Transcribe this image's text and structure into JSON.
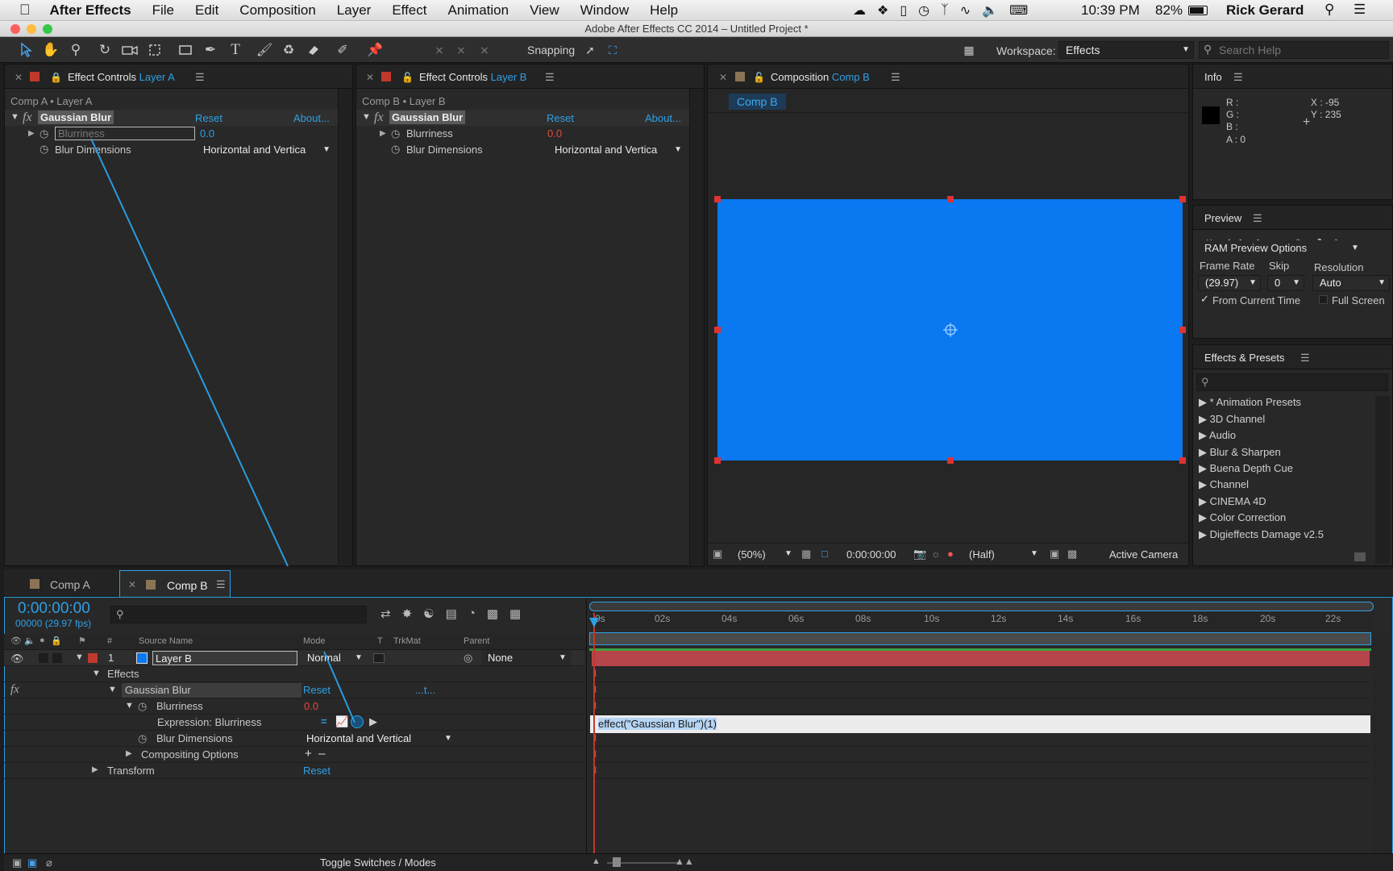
{
  "menubar": {
    "app": "After Effects",
    "items": [
      "File",
      "Edit",
      "Composition",
      "Layer",
      "Effect",
      "Animation",
      "View",
      "Window",
      "Help"
    ],
    "time": "10:39 PM",
    "battery": "82%",
    "user": "Rick Gerard"
  },
  "window": {
    "title": "Adobe After Effects CC 2014 – Untitled Project *"
  },
  "toolbar": {
    "snapping_label": "Snapping",
    "workspace_label": "Workspace:",
    "workspace_value": "Effects",
    "search_placeholder": "Search Help"
  },
  "effect_controls_a": {
    "tab_prefix": "Effect Controls",
    "tab_layer": "Layer A",
    "breadcrumb": "Comp A • Layer A",
    "effect_name": "Gaussian Blur",
    "reset": "Reset",
    "about": "About...",
    "blurriness_label": "Blurriness",
    "blurriness_value": "0.0",
    "dimensions_label": "Blur Dimensions",
    "dimensions_value": "Horizontal and Vertica"
  },
  "effect_controls_b": {
    "tab_prefix": "Effect Controls",
    "tab_layer": "Layer B",
    "breadcrumb": "Comp B • Layer B",
    "effect_name": "Gaussian Blur",
    "reset": "Reset",
    "about": "About...",
    "blurriness_label": "Blurriness",
    "blurriness_value": "0.0",
    "dimensions_label": "Blur Dimensions",
    "dimensions_value": "Horizontal and Vertica"
  },
  "composition": {
    "tab_prefix": "Composition",
    "tab_comp": "Comp B",
    "breadcrumb_tab": "Comp B",
    "solid_color": "#0a78f0",
    "zoom": "(50%)",
    "timecode": "0:00:00:00",
    "resolution": "(Half)",
    "camera": "Active Camera"
  },
  "info": {
    "tab": "Info",
    "r": "R :",
    "g": "G :",
    "b": "B :",
    "a": "A : 0",
    "x": "X : -95",
    "y": "Y : 235"
  },
  "preview": {
    "tab": "Preview",
    "ram_options": "RAM Preview Options",
    "frame_rate_label": "Frame Rate",
    "skip_label": "Skip",
    "resolution_label": "Resolution",
    "frame_rate_value": "(29.97)",
    "skip_value": "0",
    "resolution_value": "Auto",
    "from_current_time": "From Current Time",
    "full_screen": "Full Screen"
  },
  "effects_presets": {
    "tab": "Effects & Presets",
    "items": [
      "* Animation Presets",
      "3D Channel",
      "Audio",
      "Blur & Sharpen",
      "Buena Depth Cue",
      "Channel",
      "CINEMA 4D",
      "Color Correction",
      "Digieffects Damage v2.5"
    ]
  },
  "timeline": {
    "tabs": [
      "Comp A",
      "Comp B"
    ],
    "timecode": "0:00:00:00",
    "frame_info": "00000 (29.97 fps)",
    "columns": {
      "hash": "#",
      "source_name": "Source Name",
      "mode": "Mode",
      "t": "T",
      "trkmat": "TrkMat",
      "parent": "Parent"
    },
    "layer": {
      "index": "1",
      "name": "Layer B",
      "mode": "Normal",
      "parent": "None"
    },
    "effects_label": "Effects",
    "effect_name": "Gaussian Blur",
    "reset": "Reset",
    "about_short": "...t...",
    "blurriness_label": "Blurriness",
    "blurriness_value": "0.0",
    "expression_label": "Expression: Blurriness",
    "blur_dimensions_label": "Blur Dimensions",
    "blur_dimensions_value": "Horizontal and Vertical",
    "compositing_options": "Compositing Options",
    "transform_label": "Transform",
    "transform_reset": "Reset",
    "expression_text": "effect(\"Gaussian Blur\")(1)",
    "ruler": [
      "0s",
      "02s",
      "04s",
      "06s",
      "08s",
      "10s",
      "12s",
      "14s",
      "16s",
      "18s",
      "20s",
      "22s"
    ],
    "toggle_label": "Toggle Switches / Modes"
  }
}
